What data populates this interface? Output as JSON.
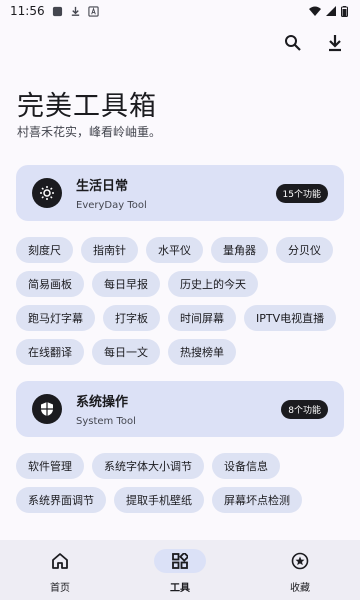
{
  "status_bar": {
    "time": "11:56"
  },
  "header": {
    "title": "完美工具箱",
    "subtitle": "村喜禾花实，峰看岭岫重。",
    "actions": {
      "search_icon": "search-icon",
      "download_icon": "download-icon"
    }
  },
  "categories": [
    {
      "title": "生活日常",
      "subtitle": "EveryDay Tool",
      "badge": "15个功能",
      "icon": "sun-settings-icon",
      "tools": [
        "刻度尺",
        "指南针",
        "水平仪",
        "量角器",
        "分贝仪",
        "简易画板",
        "每日早报",
        "历史上的今天",
        "跑马灯字幕",
        "打字板",
        "时间屏幕",
        "IPTV电视直播",
        "在线翻译",
        "每日一文",
        "热搜榜单"
      ]
    },
    {
      "title": "系统操作",
      "subtitle": "System Tool",
      "badge": "8个功能",
      "icon": "shield-icon",
      "tools": [
        "软件管理",
        "系统字体大小调节",
        "设备信息",
        "系统界面调节",
        "提取手机壁纸",
        "屏幕坏点检测"
      ]
    }
  ],
  "bottom_nav": {
    "items": [
      {
        "label": "首页",
        "icon": "home-icon"
      },
      {
        "label": "工具",
        "icon": "grid-icon",
        "active": true
      },
      {
        "label": "收藏",
        "icon": "star-icon"
      }
    ]
  },
  "colors": {
    "background": "#fbf9fd",
    "card": "#dce1f6",
    "chip": "#dde2f3",
    "badge": "#1b1b1f",
    "nav": "#eeedf4"
  }
}
